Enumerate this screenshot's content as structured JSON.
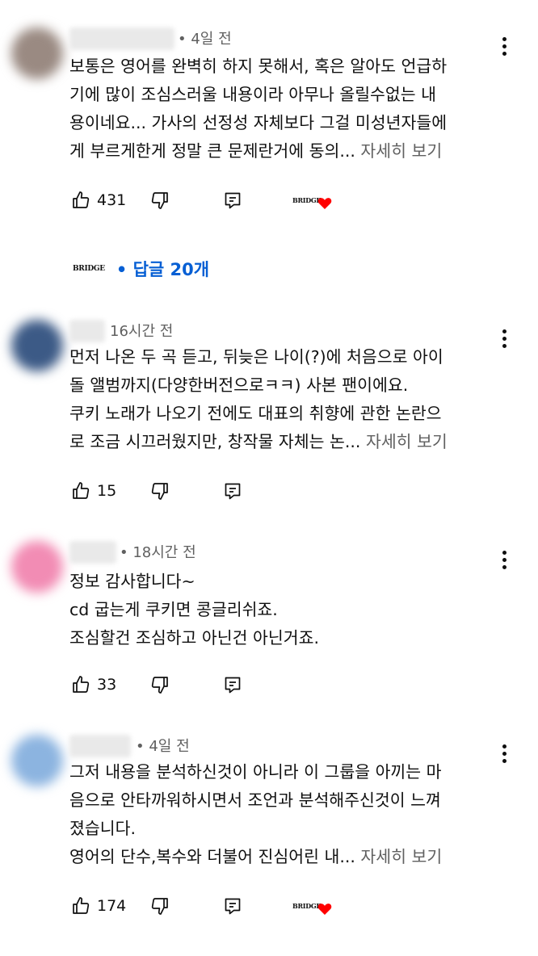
{
  "comments": [
    {
      "time": "• 4일 전",
      "lines": [
        "보통은 영어를 완벽히 하지 못해서, 혹은 알아도 언급하",
        "기에 많이 조심스러울 내용이라 아무나 올릴수없는 내",
        "용이네요... 가사의 선정성 자체보다 그걸 미성년자들에",
        "게 부르게한게 정말 큰 문제란거에 동의..."
      ],
      "more": "자세히 보기",
      "likes": "431",
      "avatar_color": "#9a8a82",
      "creator_heart": true
    },
    {
      "time": "16시간 전",
      "lines": [
        "먼저 나온 두 곡 듣고, 뒤늦은 나이(?)에 처음으로 아이",
        "돌 앨범까지(다양한버전으로ㅋㅋ) 사본 팬이에요.",
        "쿠키 노래가 나오기 전에도 대표의 취향에 관한 논란으",
        "로 조금 시끄러웠지만, 창작물 자체는 논..."
      ],
      "more": "자세히 보기",
      "likes": "15",
      "avatar_color": "#3c5a86",
      "creator_heart": false
    },
    {
      "time": "• 18시간 전",
      "lines": [
        "정보 감사합니다~",
        "cd 굽는게 쿠키면 콩글리쉬죠.",
        "조심할건 조심하고 아닌건 아닌거죠."
      ],
      "more": "",
      "likes": "33",
      "avatar_color": "#f28cb4",
      "creator_heart": false
    },
    {
      "time": "• 4일 전",
      "lines": [
        "그저 내용을 분석하신것이 아니라 이 그룹을 아끼는 마",
        "음으로 안타까워하시면서 조언과 분석해주신것이 느껴",
        "졌습니다.",
        "영어의 단수,복수와 더불어 진심어린 내..."
      ],
      "more": "자세히 보기",
      "likes": "174",
      "avatar_color": "#8cb4e0",
      "creator_heart": true
    }
  ],
  "replies": {
    "label": "• 답글 20개",
    "channel_logo": "BRIDGE"
  },
  "icons": {
    "like": "thumb-up-icon",
    "dislike": "thumb-down-icon",
    "reply": "reply-comment-icon",
    "more": "more-vert-icon",
    "heart": "heart-icon"
  },
  "colors": {
    "link_blue": "#065fd4",
    "secondary_text": "#606060",
    "heart_red": "#ff0000"
  }
}
